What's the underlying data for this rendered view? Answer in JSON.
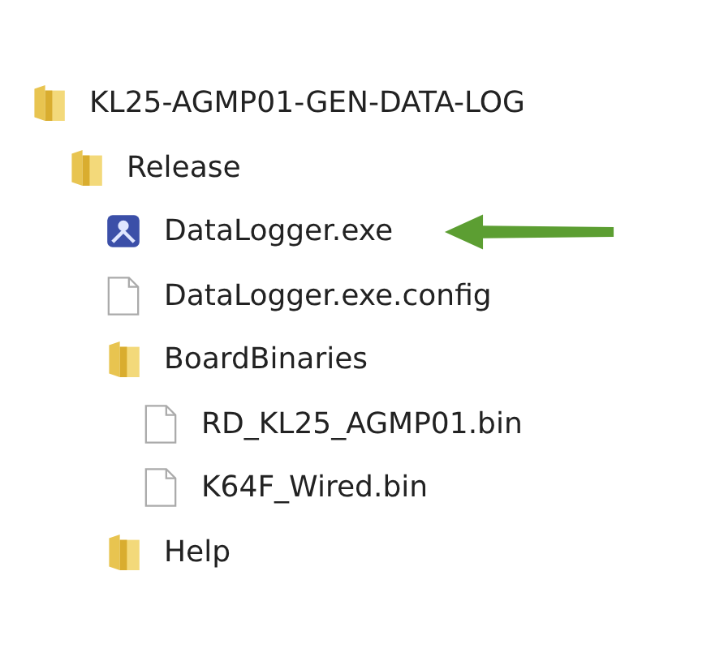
{
  "tree": [
    {
      "name": "KL25-AGMP01-GEN-DATA-LOG",
      "kind": "folder",
      "marked": false,
      "children": [
        {
          "name": "Release",
          "kind": "folder",
          "marked": false,
          "children": [
            {
              "name": "DataLogger.exe",
              "kind": "app",
              "marked": true
            },
            {
              "name": "DataLogger.exe.config",
              "kind": "file",
              "marked": false
            },
            {
              "name": "BoardBinaries",
              "kind": "folder",
              "marked": false,
              "children": [
                {
                  "name": "RD_KL25_AGMP01.bin",
                  "kind": "file",
                  "marked": false
                },
                {
                  "name": "K64F_Wired.bin",
                  "kind": "file",
                  "marked": false
                }
              ]
            },
            {
              "name": "Help",
              "kind": "folder",
              "marked": false
            }
          ]
        }
      ]
    }
  ]
}
